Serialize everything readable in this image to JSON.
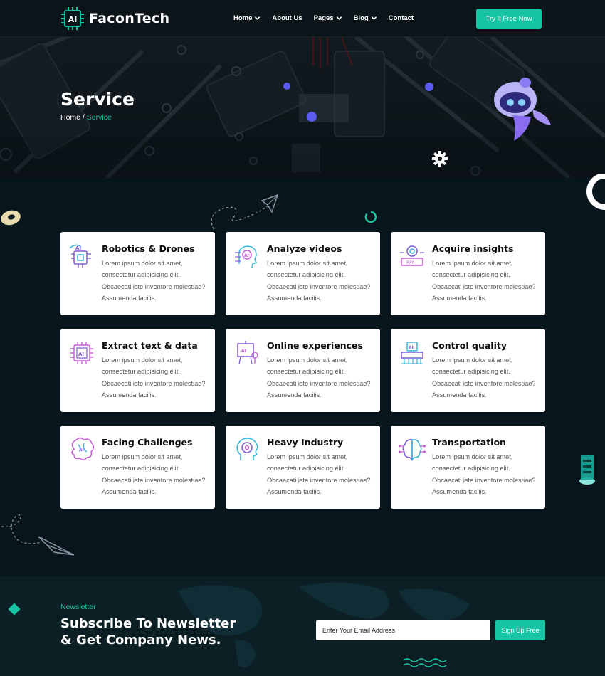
{
  "brand": {
    "name": "FaconTech",
    "logo_text": "AI"
  },
  "nav": [
    {
      "label": "Home",
      "dropdown": true
    },
    {
      "label": "About Us",
      "dropdown": false
    },
    {
      "label": "Pages",
      "dropdown": true
    },
    {
      "label": "Blog",
      "dropdown": true
    },
    {
      "label": "Contact",
      "dropdown": false
    }
  ],
  "cta_label": "Try It Free Now",
  "hero": {
    "title": "Service",
    "breadcrumb_home": "Home",
    "breadcrumb_sep": " / ",
    "breadcrumb_current": "Service"
  },
  "services": [
    {
      "title": "Robotics & Drones",
      "icon": "robotics-icon",
      "desc": "Lorem ipsum dolor sit amet, consectetur adipisicing elit. Obcaecati iste inventore molestiae? Assumenda facilis."
    },
    {
      "title": "Analyze videos",
      "icon": "ai-head-icon",
      "desc": "Lorem ipsum dolor sit amet, consectetur adipisicing elit. Obcaecati iste inventore molestiae? Assumenda facilis."
    },
    {
      "title": "Acquire insights",
      "icon": "rpa-icon",
      "desc": "Lorem ipsum dolor sit amet, consectetur adipisicing elit. Obcaecati iste inventore molestiae? Assumenda facilis."
    },
    {
      "title": "Extract text & data",
      "icon": "ai-chip-icon",
      "desc": "Lorem ipsum dolor sit amet, consectetur adipisicing elit. Obcaecati iste inventore molestiae? Assumenda facilis."
    },
    {
      "title": "Online experiences",
      "icon": "presentation-icon",
      "desc": "Lorem ipsum dolor sit amet, consectetur adipisicing elit. Obcaecati iste inventore molestiae? Assumenda facilis."
    },
    {
      "title": "Control quality",
      "icon": "ai-board-icon",
      "desc": "Lorem ipsum dolor sit amet, consectetur adipisicing elit. Obcaecati iste inventore molestiae? Assumenda facilis."
    },
    {
      "title": "Facing Challenges",
      "icon": "brain-icon",
      "desc": "Lorem ipsum dolor sit amet, consectetur adipisicing elit. Obcaecati iste inventore molestiae? Assumenda facilis."
    },
    {
      "title": "Heavy Industry",
      "icon": "gear-head-icon",
      "desc": "Lorem ipsum dolor sit amet, consectetur adipisicing elit. Obcaecati iste inventore molestiae? Assumenda facilis."
    },
    {
      "title": "Transportation",
      "icon": "circuit-brain-icon",
      "desc": "Lorem ipsum dolor sit amet, consectetur adipisicing elit. Obcaecati iste inventore molestiae? Assumenda facilis."
    }
  ],
  "newsletter": {
    "tag": "Newsletter",
    "heading_line1": "Subscribe To Newsletter",
    "heading_line2": "& Get Company News.",
    "email_placeholder": "Enter Your Email Address",
    "button_label": "Sign Up Free"
  },
  "colors": {
    "accent": "#17c4a4",
    "background": "#07161c",
    "header": "#0a1419"
  }
}
